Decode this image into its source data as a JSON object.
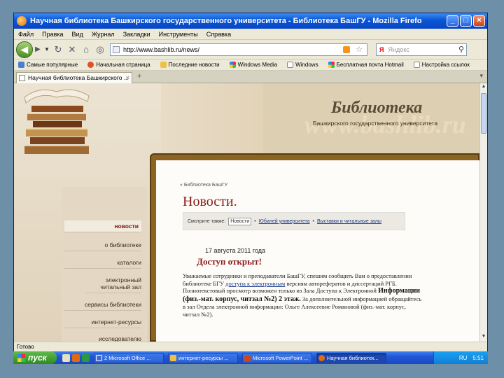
{
  "window": {
    "title": "Научная библиотека Башкирского государственного университета - Библиотека БашГУ - Mozilla Firefox"
  },
  "menu": [
    "Файл",
    "Правка",
    "Вид",
    "Журнал",
    "Закладки",
    "Инструменты",
    "Справка"
  ],
  "nav": {
    "url": "http://www.bashlib.ru/news/",
    "search_placeholder": "Яндекс",
    "search_engine": "Я"
  },
  "bookmarks": [
    "Самые популярные",
    "Начальная страница",
    "Последние новости",
    "Windows Media",
    "Windows",
    "Бесплатная почта Hotmail",
    "Настройка ссылок"
  ],
  "tab": {
    "label": "Научная библиотека Башкирского ..."
  },
  "site": {
    "title": "Библиотека",
    "subtitle": "Башкирского государственного университета",
    "watermark": "www.bashlib.ru",
    "nav": [
      "новости",
      "о библиотеке",
      "каталоги",
      "электронный читальный зал",
      "сервисы библиотеки",
      "интернет-ресурсы",
      "исследователю"
    ],
    "breadcrumb": "« Библиотека БашГУ",
    "page_title": "Новости.",
    "filter": {
      "label": "Смотрите также:",
      "selected": "Новости",
      "links": [
        "Юбилей университета",
        "Выставки и читальные залы"
      ]
    },
    "post": {
      "date": "17 августа 2011 года",
      "title": "Доступ открыт!",
      "p1": "Уважаемые сотрудники и преподаватели БашГУ, спешим сообщить Вам о предоставлении библиотеке БГУ",
      "p1_link": "доступа к электронным",
      "p2": "версиям авторефератов и диссертаций РГБ. Полнотекстовый просмотр возможен только из Зала Доступа к Электронной",
      "p3_bold": "Информации (физ.-мат. корпус, читзал №2) 2 этаж.",
      "p4": "За дополнительной информацией обращайтесь в зал Отдела электронной информации: Ольге Алексеевне Романовой (физ.-мат. корпус, читзал №2)."
    }
  },
  "status": "Готово",
  "taskbar": {
    "start": "пуск",
    "buttons": [
      "2 Microsoft Office ...",
      "интернет-ресурсы ...",
      "Microsoft PowerPoint ...",
      "Научная библиотек..."
    ],
    "lang": "RU",
    "time": "5:51"
  },
  "colors": {
    "accent": "#8c1a1a",
    "frame": "#8a6420",
    "titlebar": "#0a55d6"
  }
}
